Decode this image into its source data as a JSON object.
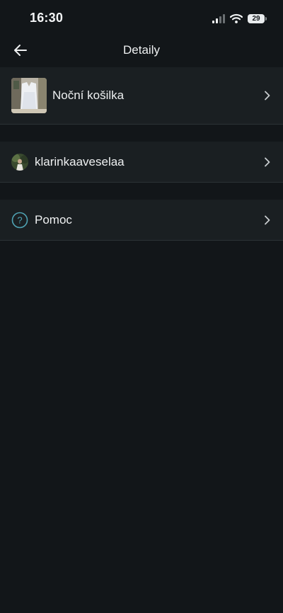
{
  "status_bar": {
    "time": "16:30",
    "battery_level": "29",
    "icons": [
      "cellular-signal-icon",
      "wifi-icon",
      "battery-icon"
    ]
  },
  "header": {
    "title": "Detaily",
    "back_icon": "arrow-left-icon"
  },
  "item": {
    "title": "Noční košilka",
    "thumbnail": "item-photo"
  },
  "seller": {
    "username": "klarinkaaveselaa",
    "avatar": "user-avatar"
  },
  "help": {
    "label": "Pomoc",
    "icon": "question-circle-icon"
  },
  "colors": {
    "background": "#121619",
    "section": "#1a1f22",
    "divider": "#2c3236",
    "text": "#eef0f1",
    "accent": "#4fa3b4"
  }
}
